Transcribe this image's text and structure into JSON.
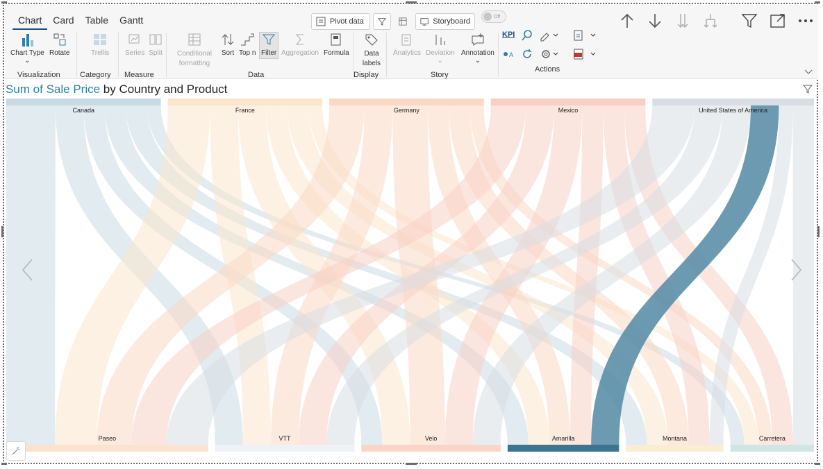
{
  "tabs": [
    "Chart",
    "Card",
    "Table",
    "Gantt"
  ],
  "top_buttons": {
    "pivot": "Pivot data",
    "storyboard": "Storyboard",
    "toggle": "Off"
  },
  "ribbon": {
    "chart_type": "Chart Type",
    "rotate": "Rotate",
    "trellis": "Trellis",
    "series": "Series",
    "split": "Split",
    "conditional_formatting": "Conditional formatting",
    "sort": "Sort",
    "top_n": "Top n",
    "filter": "Filter",
    "aggregation": "Aggregation",
    "formula": "Formula",
    "data_labels": "Data labels",
    "analytics": "Analytics",
    "deviation": "Deviation",
    "annotation": "Annotation",
    "kpi": "KPI"
  },
  "groups": {
    "visualization": "Visualization",
    "category": "Category",
    "measure": "Measure",
    "data": "Data",
    "display": "Display",
    "story": "Story",
    "actions": "Actions"
  },
  "chart_title": {
    "measure": "Sum of Sale Price",
    "rest": "by Country and Product"
  },
  "colors": {
    "Canada": "#c8dae3",
    "France": "#fbe6cc",
    "Germany": "#fbd8c4",
    "Mexico": "#f7cfc5",
    "United States of America": "#d8dee3",
    "highlight_link": "#5b8fa8",
    "highlight_node": "#3d7590"
  },
  "chart_data": {
    "type": "sankey",
    "title": "Sum of Sale Price by Country and Product",
    "sources": [
      "Canada",
      "France",
      "Germany",
      "Mexico",
      "United States of America"
    ],
    "targets": [
      "Paseo",
      "VTT",
      "Velo",
      "Amarilla",
      "Montana",
      "Carretera"
    ],
    "links": [
      {
        "source": "Canada",
        "target": "Paseo",
        "value": 7
      },
      {
        "source": "Canada",
        "target": "VTT",
        "value": 4
      },
      {
        "source": "Canada",
        "target": "Velo",
        "value": 3
      },
      {
        "source": "Canada",
        "target": "Amarilla",
        "value": 3
      },
      {
        "source": "Canada",
        "target": "Montana",
        "value": 3
      },
      {
        "source": "Canada",
        "target": "Carretera",
        "value": 2
      },
      {
        "source": "France",
        "target": "Paseo",
        "value": 6
      },
      {
        "source": "France",
        "target": "VTT",
        "value": 4
      },
      {
        "source": "France",
        "target": "Velo",
        "value": 4
      },
      {
        "source": "France",
        "target": "Amarilla",
        "value": 3
      },
      {
        "source": "France",
        "target": "Montana",
        "value": 3
      },
      {
        "source": "France",
        "target": "Carretera",
        "value": 2
      },
      {
        "source": "Germany",
        "target": "Paseo",
        "value": 5
      },
      {
        "source": "Germany",
        "target": "VTT",
        "value": 4
      },
      {
        "source": "Germany",
        "target": "Velo",
        "value": 5
      },
      {
        "source": "Germany",
        "target": "Amarilla",
        "value": 3
      },
      {
        "source": "Germany",
        "target": "Montana",
        "value": 3
      },
      {
        "source": "Germany",
        "target": "Carretera",
        "value": 2
      },
      {
        "source": "Mexico",
        "target": "Paseo",
        "value": 5
      },
      {
        "source": "Mexico",
        "target": "VTT",
        "value": 4
      },
      {
        "source": "Mexico",
        "target": "Velo",
        "value": 4
      },
      {
        "source": "Mexico",
        "target": "Amarilla",
        "value": 3
      },
      {
        "source": "Mexico",
        "target": "Montana",
        "value": 3
      },
      {
        "source": "Mexico",
        "target": "Carretera",
        "value": 3
      },
      {
        "source": "United States of America",
        "target": "Paseo",
        "value": 6
      },
      {
        "source": "United States of America",
        "target": "VTT",
        "value": 4
      },
      {
        "source": "United States of America",
        "target": "Velo",
        "value": 4
      },
      {
        "source": "United States of America",
        "target": "Amarilla",
        "value": 4
      },
      {
        "source": "United States of America",
        "target": "Montana",
        "value": 2
      },
      {
        "source": "United States of America",
        "target": "Carretera",
        "value": 3
      }
    ],
    "highlighted": {
      "source": "United States of America",
      "target": "Amarilla"
    }
  }
}
